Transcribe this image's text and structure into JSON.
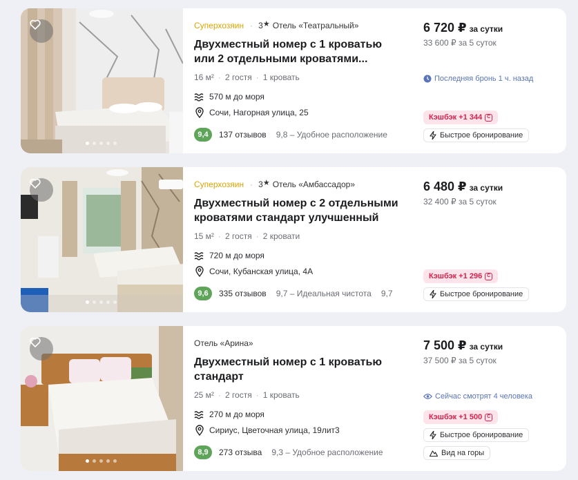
{
  "listings": [
    {
      "superhost": "Суперхозяин",
      "stars": "3",
      "hotel": "Отель «Театральный»",
      "title_line1": "Двухместный номер с 1 кроватью",
      "title_line2": "или 2 отдельными кроватями...",
      "area": "16 м²",
      "guests": "2 гостя",
      "beds": "1 кровать",
      "distance": "570 м до моря",
      "address": "Сочи, Нагорная улица, 25",
      "rating": "9,4",
      "reviews": "137 отзывов",
      "rating_meta": "9,8 – Удобное расположение",
      "price": "6 720 ₽",
      "price_per": "за сутки",
      "total": "33 600 ₽ за 5 суток",
      "status": "Последняя бронь 1 ч. назад",
      "cashback": "Кэшбэк +1 344",
      "chips": [
        "Быстрое бронирование"
      ]
    },
    {
      "superhost": "Суперхозяин",
      "stars": "3",
      "hotel": "Отель «Амбассадор»",
      "title_line1": "Двухместный номер с 2 отдельными",
      "title_line2": "кроватями стандарт улучшенный",
      "area": "15 м²",
      "guests": "2 гостя",
      "beds": "2 кровати",
      "distance": "720 м до моря",
      "address": "Сочи, Кубанская улица, 4А",
      "rating": "9,6",
      "reviews": "335 отзывов",
      "rating_meta": "9,7 – Идеальная чистота",
      "rating_meta2": "9,7",
      "price": "6 480 ₽",
      "price_per": "за сутки",
      "total": "32 400 ₽ за 5 суток",
      "cashback": "Кэшбэк +1 296",
      "chips": [
        "Быстрое бронирование"
      ]
    },
    {
      "hotel": "Отель «Арина»",
      "title_line1": "Двухместный номер с 1 кроватью",
      "title_line2": "стандарт",
      "area": "25 м²",
      "guests": "2 гостя",
      "beds": "1 кровать",
      "distance": "270 м до моря",
      "address": "Сириус, Цветочная улица, 19лит3",
      "rating": "8,9",
      "reviews": "273 отзыва",
      "rating_meta": "9,3 – Удобное расположение",
      "price": "7 500 ₽",
      "price_per": "за сутки",
      "total": "37 500 ₽ за 5 суток",
      "status": "Сейчас смотрят 4 человека",
      "cashback": "Кэшбэк +1 500",
      "chips": [
        "Быстрое бронирование",
        "Вид на горы"
      ]
    }
  ],
  "icons": {
    "favorite": "heart-icon",
    "sea": "waves-icon",
    "location": "pin-icon",
    "instant": "lightning-icon",
    "recent": "clock-icon",
    "viewers": "eye-icon",
    "view": "mountain-icon",
    "cashback": "cashback-icon"
  },
  "colors": {
    "superhost": "#d9a600",
    "rating_badge": "#5ea55a",
    "cashback_bg": "#fde3ea",
    "cashback_text": "#d3234c",
    "status": "#5a74b8"
  }
}
